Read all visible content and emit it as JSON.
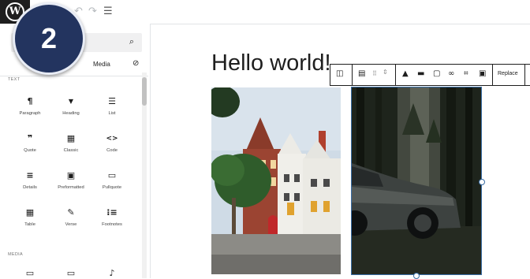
{
  "topbar": {
    "logo_glyph": "W",
    "undo_icon": "↶",
    "redo_icon": "↷",
    "outline_icon": "☰"
  },
  "tutorial_badge": {
    "step": "2"
  },
  "inserter": {
    "search_icon": "⌕",
    "tabs": {
      "media": "Media"
    },
    "sections": {
      "text": "TEXT",
      "media": "MEDIA"
    },
    "text_blocks": [
      {
        "name": "paragraph",
        "label": "Paragraph",
        "glyph": "¶"
      },
      {
        "name": "heading",
        "label": "Heading",
        "glyph": "▼"
      },
      {
        "name": "list",
        "label": "List",
        "glyph": "☰"
      },
      {
        "name": "quote",
        "label": "Quote",
        "glyph": "❞"
      },
      {
        "name": "classic",
        "label": "Classic",
        "glyph": "▦"
      },
      {
        "name": "code",
        "label": "Code",
        "glyph": "<>"
      },
      {
        "name": "details",
        "label": "Details",
        "glyph": "≡"
      },
      {
        "name": "preformatted",
        "label": "Preformatted",
        "glyph": "▣"
      },
      {
        "name": "pullquote",
        "label": "Pullquote",
        "glyph": "▭"
      },
      {
        "name": "table",
        "label": "Table",
        "glyph": "▦"
      },
      {
        "name": "verse",
        "label": "Verse",
        "glyph": "✎"
      },
      {
        "name": "footnotes",
        "label": "Footnotes",
        "glyph": "⁝≡"
      }
    ]
  },
  "editor": {
    "post_title": "Hello world!",
    "block_toolbar": {
      "replace_label": "Replace"
    }
  },
  "images": [
    {
      "subject": "brick townhouses with tree"
    },
    {
      "subject": "car in dark forest"
    }
  ]
}
